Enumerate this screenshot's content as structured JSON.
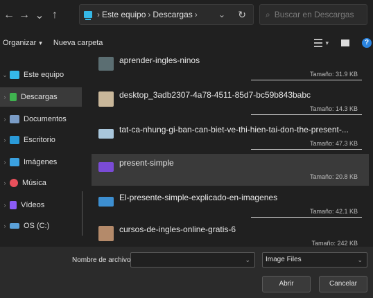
{
  "nav": {
    "back": "←",
    "forward": "→",
    "recent": "⌄",
    "up": "↑"
  },
  "address": {
    "crumbs": [
      "Este equipo",
      "Descargas"
    ],
    "separator": "›",
    "dropdown": "⌄",
    "refresh": "↻"
  },
  "search": {
    "icon": "⌕",
    "placeholder": "Buscar en Descargas"
  },
  "toolbar": {
    "organize_label": "Organizar",
    "organize_caret": "▾",
    "new_folder_label": "Nueva carpeta",
    "view_caret": "▾",
    "help": "?"
  },
  "sidebar": {
    "items": [
      {
        "label": "Este equipo",
        "icon": "pc-icon",
        "color": "#35b9e8",
        "chevron": "⌄",
        "selected": false
      },
      {
        "label": "Descargas",
        "icon": "downloads-icon",
        "color": "#3fb34f",
        "chevron": "›",
        "selected": true
      },
      {
        "label": "Documentos",
        "icon": "documents-icon",
        "color": "#7a9cc6",
        "chevron": "›",
        "selected": false
      },
      {
        "label": "Escritorio",
        "icon": "desktop-icon",
        "color": "#2a9ad8",
        "chevron": "›",
        "selected": false
      },
      {
        "label": "Imágenes",
        "icon": "pictures-icon",
        "color": "#3ba1e0",
        "chevron": "›",
        "selected": false
      },
      {
        "label": "Música",
        "icon": "music-icon",
        "color": "#e8505b",
        "chevron": "›",
        "selected": false
      },
      {
        "label": "Vídeos",
        "icon": "videos-icon",
        "color": "#8b5cf6",
        "chevron": "›",
        "selected": false
      },
      {
        "label": "OS (C:)",
        "icon": "drive-icon",
        "color": "#5aa0d8",
        "chevron": "›",
        "selected": false
      }
    ]
  },
  "files": [
    {
      "name": "aprender-ingles-ninos",
      "size": "Tamaño: 31.9 KB",
      "thumb": "#5b6e72",
      "selected": false
    },
    {
      "name": "desktop_3adb2307-4a78-4511-85d7-bc59b843babc",
      "size": "Tamaño: 14.3 KB",
      "thumb": "#c9b79a",
      "selected": false
    },
    {
      "name": "tat-ca-nhung-gi-ban-can-biet-ve-thi-hien-tai-don-the-present-...",
      "size": "Tamaño: 47.3 KB",
      "thumb": "#a9c7dc",
      "selected": false
    },
    {
      "name": "present-simple",
      "size": "Tamaño: 20.8 KB",
      "thumb": "#7a4bd6",
      "selected": true
    },
    {
      "name": "El-presente-simple-explicado-en-imagenes",
      "size": "Tamaño: 42.1 KB",
      "thumb": "#3d8fd1",
      "selected": false
    },
    {
      "name": "cursos-de-ingles-online-gratis-6",
      "size": "Tamaño: 242 KB",
      "thumb": "#b48a6a",
      "selected": false
    }
  ],
  "bottom": {
    "filename_label": "Nombre de archivo:",
    "filename_value": "",
    "filename_dropdown": "⌄",
    "filter_value": "Image Files",
    "filter_dropdown": "⌄",
    "open_label": "Abrir",
    "cancel_label": "Cancelar"
  }
}
